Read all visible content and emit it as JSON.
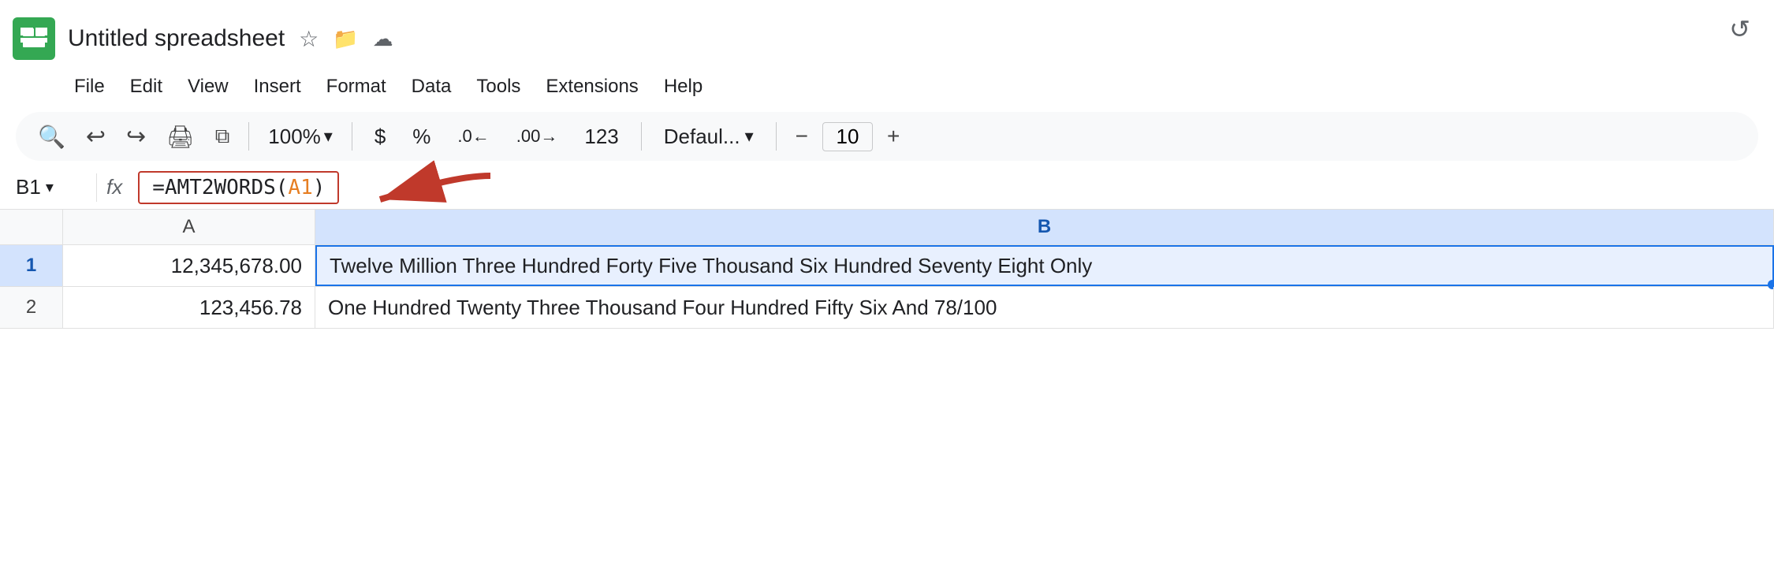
{
  "app": {
    "logo_alt": "Google Sheets",
    "title": "Untitled spreadsheet"
  },
  "title_icons": {
    "star": "☆",
    "folder": "⊡",
    "cloud": "☁"
  },
  "menu": {
    "items": [
      "File",
      "Edit",
      "View",
      "Insert",
      "Format",
      "Data",
      "Tools",
      "Extensions",
      "Help"
    ]
  },
  "toolbar": {
    "search": "🔍",
    "undo": "↩",
    "redo": "↪",
    "print": "🖨",
    "format_paint": "⧉",
    "zoom_label": "100%",
    "currency": "$",
    "percent": "%",
    "decimal_dec": ".0←",
    "decimal_inc": ".00→",
    "number_format": "123",
    "font_name": "Defaul...",
    "font_size": "10",
    "minus_label": "−",
    "plus_label": "+"
  },
  "formula_bar": {
    "cell_ref": "B1",
    "fx_label": "fx",
    "formula_prefix": "=AMT2WORDS(",
    "formula_arg": "A1",
    "formula_suffix": ")"
  },
  "grid": {
    "col_a_header": "A",
    "col_b_header": "B",
    "rows": [
      {
        "num": "1",
        "active": true,
        "col_a": "12,345,678.00",
        "col_b": "Twelve Million Three Hundred Forty Five Thousand Six Hundred Seventy Eight Only"
      },
      {
        "num": "2",
        "active": false,
        "col_a": "123,456.78",
        "col_b": "One Hundred Twenty Three Thousand Four Hundred Fifty Six And 78/100"
      }
    ]
  },
  "undo_top_icon": "↺"
}
